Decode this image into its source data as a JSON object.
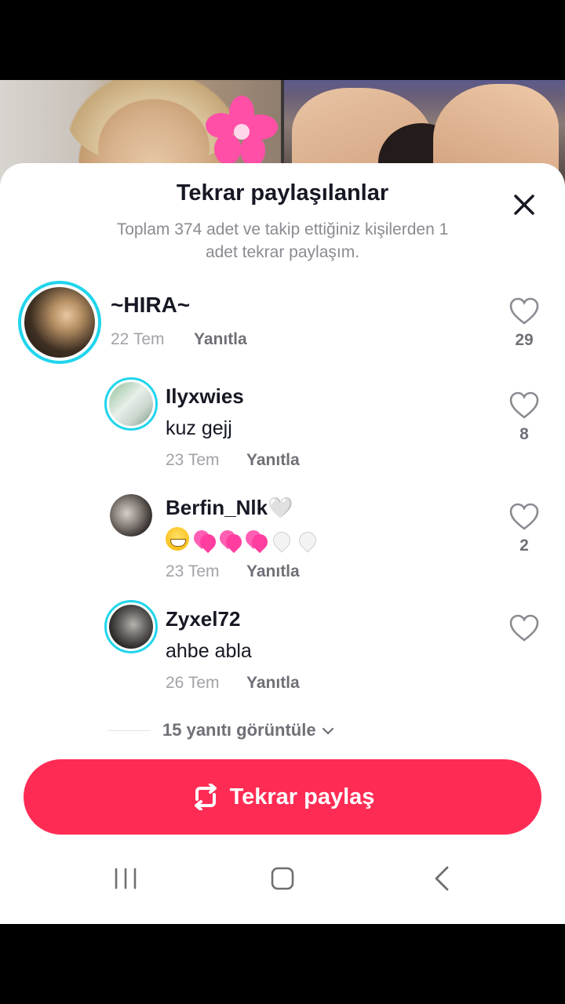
{
  "sheet": {
    "title": "Tekrar paylaşılanlar",
    "subtitle": "Toplam 374 adet ve takip ettiğiniz kişilerden 1 adet tekrar paylaşım."
  },
  "comments": [
    {
      "username": "~HIRA~",
      "text": "",
      "date": "22 Tem",
      "reply_label": "Yanıtla",
      "likes": "29"
    },
    {
      "username": "Ilyxwies",
      "text": "kuz gejj",
      "date": "23 Tem",
      "reply_label": "Yanıtla",
      "likes": "8"
    },
    {
      "username": "Berfin_Nlk🤍",
      "text": "😁💞💞💞🤍🤍",
      "date": "23 Tem",
      "reply_label": "Yanıtla",
      "likes": "2"
    },
    {
      "username": "Zyxel72",
      "text": "ahbe abla",
      "date": "26 Tem",
      "reply_label": "Yanıtla",
      "likes": ""
    }
  ],
  "view_replies": "15 yanıtı görüntüle",
  "repost_button": "Tekrar paylaş",
  "colors": {
    "accent": "#fe2c55",
    "ring": "#20d5ec"
  },
  "icons": [
    "close-icon",
    "heart-icon",
    "repost-icon",
    "chevron-down-icon",
    "recent-apps-icon",
    "home-icon",
    "back-icon"
  ]
}
